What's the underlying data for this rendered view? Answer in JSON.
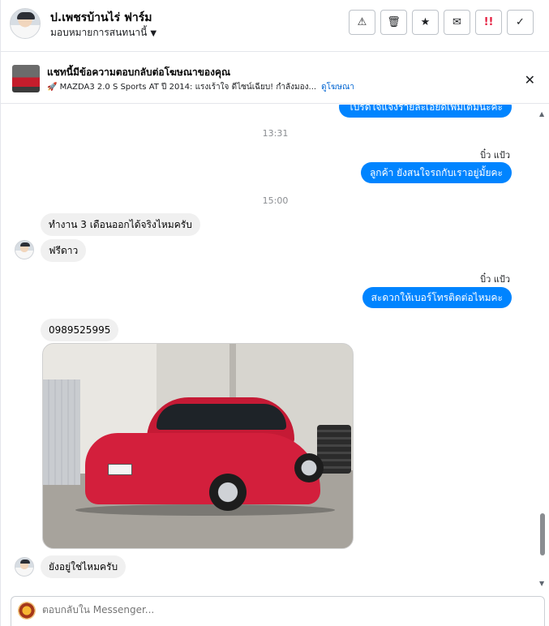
{
  "header": {
    "name": "ป.เพชรบ้านไร่ ฟาร์ม",
    "assign_label": "มอบหมายการสนทนานี้",
    "actions": [
      {
        "icon": "warning-icon",
        "glyph": "⚠"
      },
      {
        "icon": "trash-icon",
        "glyph": "🗑"
      },
      {
        "icon": "star-icon",
        "glyph": "★"
      },
      {
        "icon": "mark-unread-icon",
        "glyph": "✉"
      },
      {
        "icon": "follow-up-icon",
        "glyph": "!!"
      },
      {
        "icon": "checkmark-icon",
        "glyph": "✓"
      }
    ]
  },
  "ad_banner": {
    "title": "แชทนี้มีข้อความตอบกลับต่อโฆษณาของคุณ",
    "subtitle": "🚀 MAZDA3 2.0 S Sports AT ปี 2014: แรงเร้าใจ ดีไซน์เฉียบ! กำลังมอง...",
    "link": "ดูโฆษณา",
    "close_glyph": "✕"
  },
  "messages": {
    "m0": "โปรดใจแจงรายละเอียดเพิ่มเติมนะคะ",
    "ts1": "13:31",
    "sender1": "บิ๋ว แป้ว",
    "m1": "ลูกค้า ยังสนใจรถกับเราอยู่มั้ยคะ",
    "ts2": "15:00",
    "m2": "ทำงาน 3 เดือนออกได้จริงไหมครับ",
    "m3": "ฟรีดาว",
    "sender2": "บิ๋ว แป้ว",
    "m4": "สะดวกให้เบอร์โทรติดต่อไหมคะ",
    "m5": "0989525995",
    "m6": "ยังอยู่ใช่ไหมครับ"
  },
  "composer": {
    "placeholder": "ตอบกลับใน Messenger..."
  }
}
